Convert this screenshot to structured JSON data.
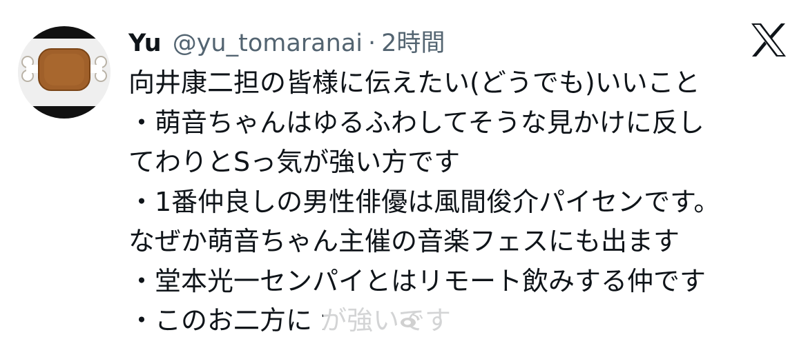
{
  "tweet": {
    "author": {
      "name": "Yu",
      "handle": "@yu_tomaranai",
      "separator": "·",
      "time": "2時間"
    },
    "avatar": {
      "icon": "meat-on-bone-icon",
      "background_color": "#efefef",
      "meat_color": "#a0602a",
      "bone_color": "#ffffff"
    },
    "platform_logo": "x-logo-icon",
    "lines": [
      "向井康二担の皆様に伝えたい(どうでも)いいこと",
      "・萌音ちゃんはゆるふわしてそうな見かけに反し",
      "てわりとSっ気が強い方です",
      "・1番仲良しの男性俳優は風間俊介パイセンです。",
      "なぜか萌音ちゃん主催の音楽フェスにも出ます",
      "・堂本光一センパイとはリモート飲みする仲です",
      "・このお二方に                                  が強いです"
    ]
  },
  "watermark": {
    "icon": "weibo-logo-icon"
  },
  "colors": {
    "text": "#0f1419",
    "secondary_text": "#536471",
    "background": "#ffffff"
  }
}
